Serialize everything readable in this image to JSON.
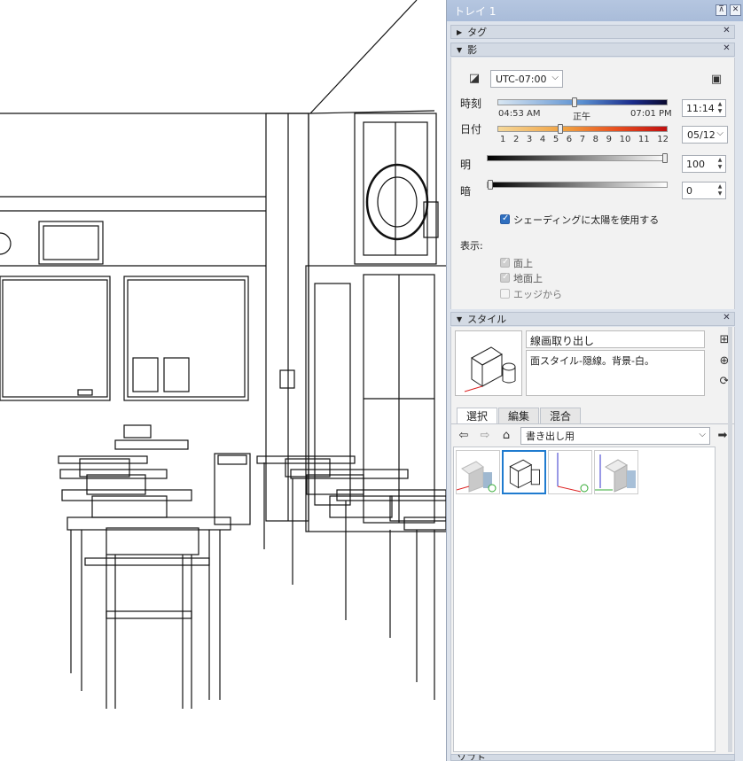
{
  "tray": {
    "title": "トレイ 1",
    "pin_icon": "pin-icon",
    "close_icon": "close-icon"
  },
  "panels": {
    "tag": {
      "label": "タグ",
      "collapsed": true
    },
    "shadow": {
      "label": "影",
      "timezone": "UTC-07:00",
      "time_label": "時刻",
      "time_start": "04:53 AM",
      "time_noon": "正午",
      "time_end": "07:01 PM",
      "time_value": "11:14",
      "date_label": "日付",
      "months": [
        "1",
        "2",
        "3",
        "4",
        "5",
        "6",
        "7",
        "8",
        "9",
        "10",
        "11",
        "12"
      ],
      "date_value": "05/12",
      "light_label": "明",
      "light_value": "100",
      "dark_label": "暗",
      "dark_value": "0",
      "use_sun_label": "シェーディングに太陽を使用する",
      "use_sun_checked": true,
      "display_label": "表示:",
      "on_faces_label": "面上",
      "on_ground_label": "地面上",
      "from_edges_label": "エッジから",
      "on_faces_checked": true,
      "on_ground_checked": true,
      "from_edges_checked": false
    },
    "style": {
      "label": "スタイル",
      "name": "線画取り出し",
      "description": "面スタイル-隠線。背景-白。",
      "tabs": [
        "選択",
        "編集",
        "混合"
      ],
      "active_tab": "選択",
      "collection": "書き出し用"
    },
    "bottom_label": "ソフト"
  },
  "colors": {
    "accent": "#1f7bcf",
    "tray_title": "#b5c6e0",
    "checkbox_blue": "#2f6fbf"
  }
}
